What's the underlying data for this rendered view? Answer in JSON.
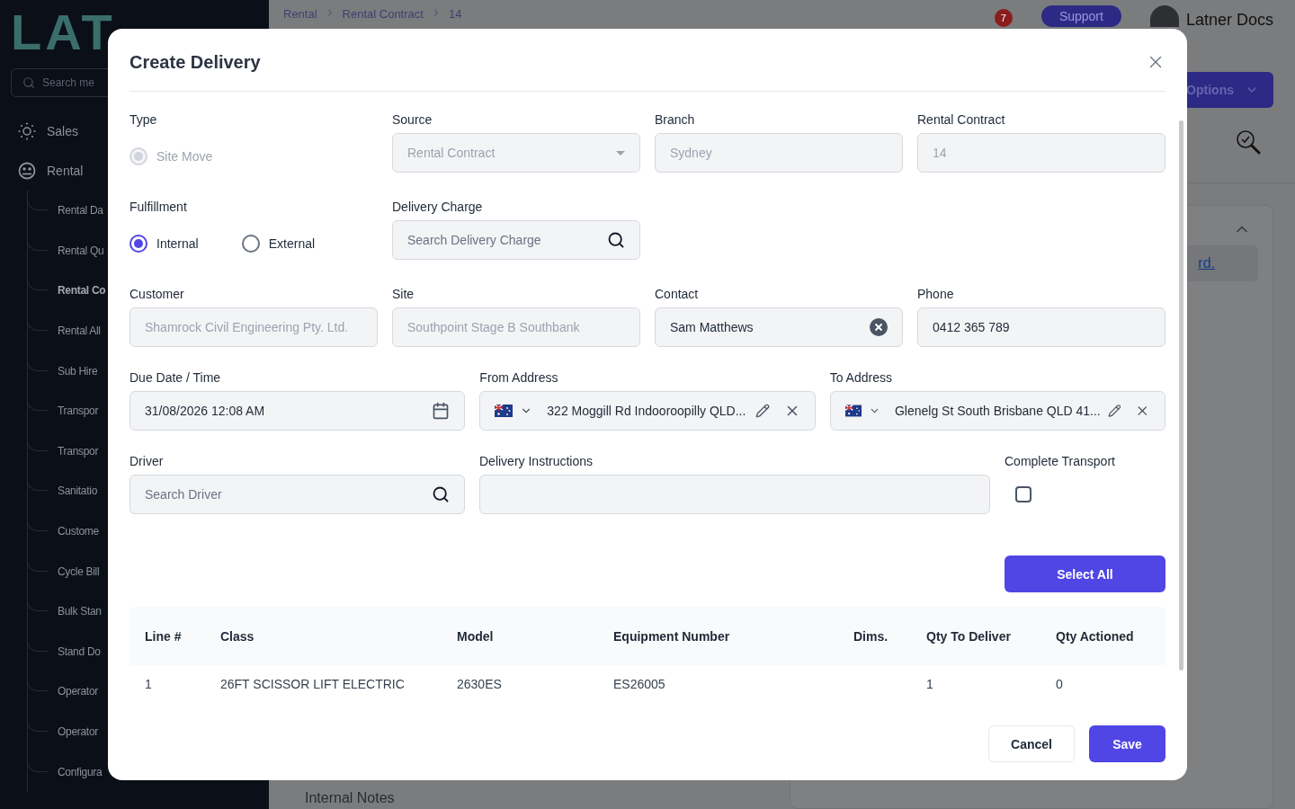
{
  "sidebar": {
    "logo": "LAT",
    "search": {
      "placeholder": "Search me"
    },
    "sections": [
      {
        "label": "Sales"
      },
      {
        "label": "Rental",
        "children": [
          {
            "label": "Rental Da",
            "selected": false
          },
          {
            "label": "Rental Qu",
            "selected": false
          },
          {
            "label": "Rental Co",
            "selected": true
          },
          {
            "label": "Rental All",
            "selected": false
          },
          {
            "label": "Sub Hire",
            "selected": false
          },
          {
            "label": "Transpor",
            "selected": false
          },
          {
            "label": "Transpor",
            "selected": false
          },
          {
            "label": "Sanitatio",
            "selected": false
          },
          {
            "label": "Custome",
            "selected": false
          },
          {
            "label": "Cycle Bill",
            "selected": false
          },
          {
            "label": "Bulk Stan",
            "selected": false
          },
          {
            "label": "Stand Do",
            "selected": false
          },
          {
            "label": "Operator",
            "selected": false
          },
          {
            "label": "Operator",
            "selected": false
          },
          {
            "label": "Configura",
            "selected": false
          }
        ]
      }
    ]
  },
  "header": {
    "breadcrumb": [
      "Rental",
      "Rental Contract",
      "14"
    ],
    "notifications": "7",
    "support": "Support",
    "user": "Latner Docs",
    "options": "Options"
  },
  "background": {
    "link": "rd.",
    "notes_label": "Internal Notes"
  },
  "dialog": {
    "title": "Create Delivery",
    "rows": [
      [
        {
          "kind": "radio",
          "label": "Type",
          "options": [
            {
              "label": "Site Move",
              "selected": true,
              "disabled": true
            }
          ]
        },
        {
          "kind": "select",
          "label": "Source",
          "value": "Rental Contract",
          "disabled": true
        },
        {
          "kind": "text",
          "label": "Branch",
          "value": "Sydney",
          "disabled": true
        },
        {
          "kind": "text",
          "label": "Rental Contract",
          "value": "14",
          "disabled": true
        }
      ],
      [
        {
          "kind": "radio",
          "label": "Fulfillment",
          "options": [
            {
              "label": "Internal",
              "selected": true,
              "disabled": false
            },
            {
              "label": "External",
              "selected": false,
              "disabled": false
            }
          ]
        },
        {
          "kind": "search",
          "label": "Delivery Charge",
          "placeholder": "Search Delivery Charge"
        }
      ],
      [
        {
          "kind": "text",
          "label": "Customer",
          "value": "Shamrock Civil Engineering Pty. Ltd.",
          "disabled": true
        },
        {
          "kind": "text",
          "label": "Site",
          "value": "Southpoint Stage B Southbank",
          "disabled": true
        },
        {
          "kind": "clearable",
          "label": "Contact",
          "value": "Sam Matthews"
        },
        {
          "kind": "text",
          "label": "Phone",
          "value": "0412 365 789",
          "disabled": false
        }
      ],
      [
        {
          "kind": "date",
          "label": "Due Date / Time",
          "value": "31/08/2026 12:08 AM"
        },
        {
          "kind": "address",
          "label": "From Address",
          "value": "322 Moggill Rd Indooroopilly QLD..."
        },
        {
          "kind": "address",
          "label": "To Address",
          "value": "Glenelg St South Brisbane QLD 41..."
        }
      ],
      [
        {
          "kind": "search",
          "label": "Driver",
          "placeholder": "Search Driver"
        },
        {
          "kind": "textarea",
          "label": "Delivery Instructions"
        },
        {
          "kind": "checkbox",
          "label": "Complete Transport",
          "checked": false
        }
      ]
    ],
    "select_all": "Select All",
    "table": {
      "columns": [
        "Line #",
        "Class",
        "Model",
        "Equipment Number",
        "Dims.",
        "Qty To Deliver",
        "Qty Actioned"
      ],
      "rows": [
        [
          "1",
          "26FT SCISSOR LIFT ELECTRIC",
          "2630ES",
          "ES26005",
          "",
          "1",
          "0"
        ]
      ]
    },
    "buttons": [
      {
        "label": "Cancel",
        "kind": "secondary"
      },
      {
        "label": "Save",
        "kind": "primary"
      }
    ]
  }
}
